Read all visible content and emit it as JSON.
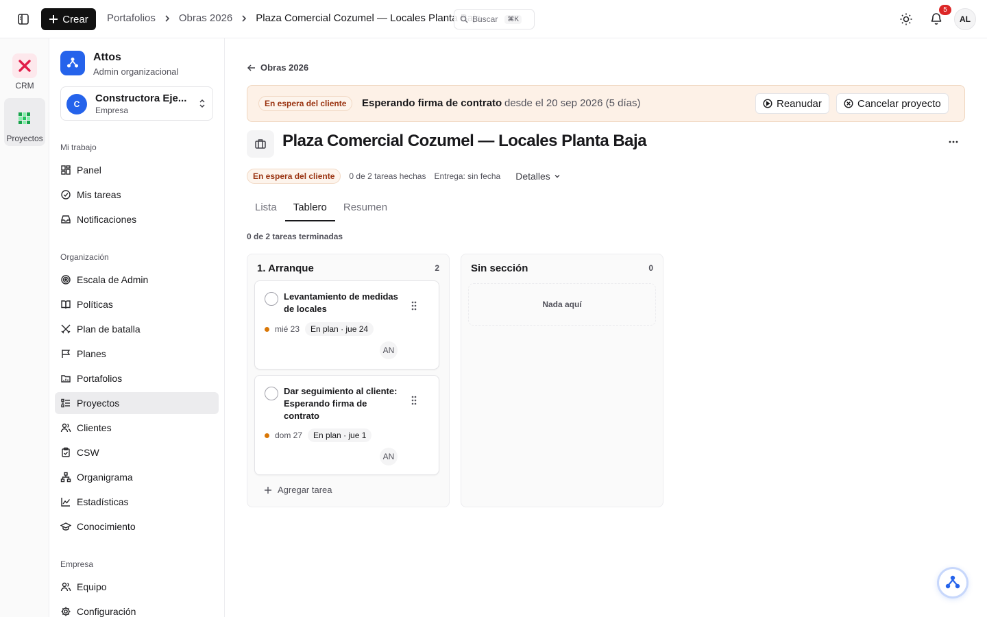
{
  "topbar": {
    "create_label": "Crear",
    "breadcrumb": [
      "Portafolios",
      "Obras 2026",
      "Plaza Comercial Cozumel — Locales Planta Baja"
    ],
    "search_placeholder": "Buscar",
    "search_shortcut": "⌘K",
    "notifications_count": "5",
    "user_initials": "AL"
  },
  "rail": [
    {
      "label": "CRM",
      "icon": "crm-x-icon",
      "color": "#e11d48"
    },
    {
      "label": "Proyectos",
      "icon": "proyectos-grid-icon",
      "color": "#16a34a"
    }
  ],
  "sidebar": {
    "org_name": "Attos",
    "org_role": "Admin organizacional",
    "company_initial": "C",
    "company_name": "Constructora Eje...",
    "company_type": "Empresa",
    "sections": [
      {
        "label": "Mi trabajo",
        "items": [
          {
            "label": "Panel",
            "icon": "dashboard-icon"
          },
          {
            "label": "Mis tareas",
            "icon": "check-circle-icon"
          },
          {
            "label": "Notificaciones",
            "icon": "inbox-icon"
          }
        ]
      },
      {
        "label": "Organización",
        "items": [
          {
            "label": "Escala de Admin",
            "icon": "target-icon"
          },
          {
            "label": "Políticas",
            "icon": "book-icon"
          },
          {
            "label": "Plan de batalla",
            "icon": "swords-icon"
          },
          {
            "label": "Planes",
            "icon": "flag-icon"
          },
          {
            "label": "Portafolios",
            "icon": "folder-icon"
          },
          {
            "label": "Proyectos",
            "icon": "list-icon"
          },
          {
            "label": "Clientes",
            "icon": "users-icon"
          },
          {
            "label": "CSW",
            "icon": "clipboard-icon"
          },
          {
            "label": "Organigrama",
            "icon": "org-chart-icon"
          },
          {
            "label": "Estadísticas",
            "icon": "line-chart-icon"
          },
          {
            "label": "Conocimiento",
            "icon": "graduation-cap-icon"
          }
        ]
      },
      {
        "label": "Empresa",
        "items": [
          {
            "label": "Equipo",
            "icon": "users-icon"
          },
          {
            "label": "Configuración",
            "icon": "gear-icon"
          }
        ]
      }
    ]
  },
  "main": {
    "back_label": "Obras 2026",
    "banner": {
      "status": "En espera del cliente",
      "title": "Esperando firma de contrato",
      "since": "desde el 20 sep 2026 (5 días)",
      "resume_label": "Reanudar",
      "cancel_label": "Cancelar proyecto"
    },
    "project_title": "Plaza Comercial Cozumel — Locales Planta Baja",
    "meta": {
      "status": "En espera del cliente",
      "tasks_done": "0 de 2 tareas hechas",
      "delivery": "Entrega: sin fecha",
      "details_label": "Detalles"
    },
    "tabs": [
      {
        "label": "Lista",
        "active": false
      },
      {
        "label": "Tablero",
        "active": true
      },
      {
        "label": "Resumen",
        "active": false
      }
    ],
    "progress_text": "0 de 2 tareas terminadas",
    "columns": [
      {
        "title": "1. Arranque",
        "count": "2",
        "cards": [
          {
            "title": "Levantamiento de medidas de locales",
            "due": "mié 23",
            "plan": "En plan · jue 24",
            "assignee": "AN"
          },
          {
            "title": "Dar seguimiento al cliente: Esperando firma de contrato",
            "due": "dom 27",
            "plan": "En plan · jue 1",
            "assignee": "AN"
          }
        ],
        "add_label": "Agregar tarea"
      },
      {
        "title": "Sin sección",
        "count": "0",
        "empty_label": "Nada aquí"
      }
    ]
  },
  "colors": {
    "accent": "#2563eb",
    "banner_bg": "#fdf1e7",
    "status_text": "#9a3412",
    "due_dot": "#d97706",
    "badge": "#dc2626"
  }
}
